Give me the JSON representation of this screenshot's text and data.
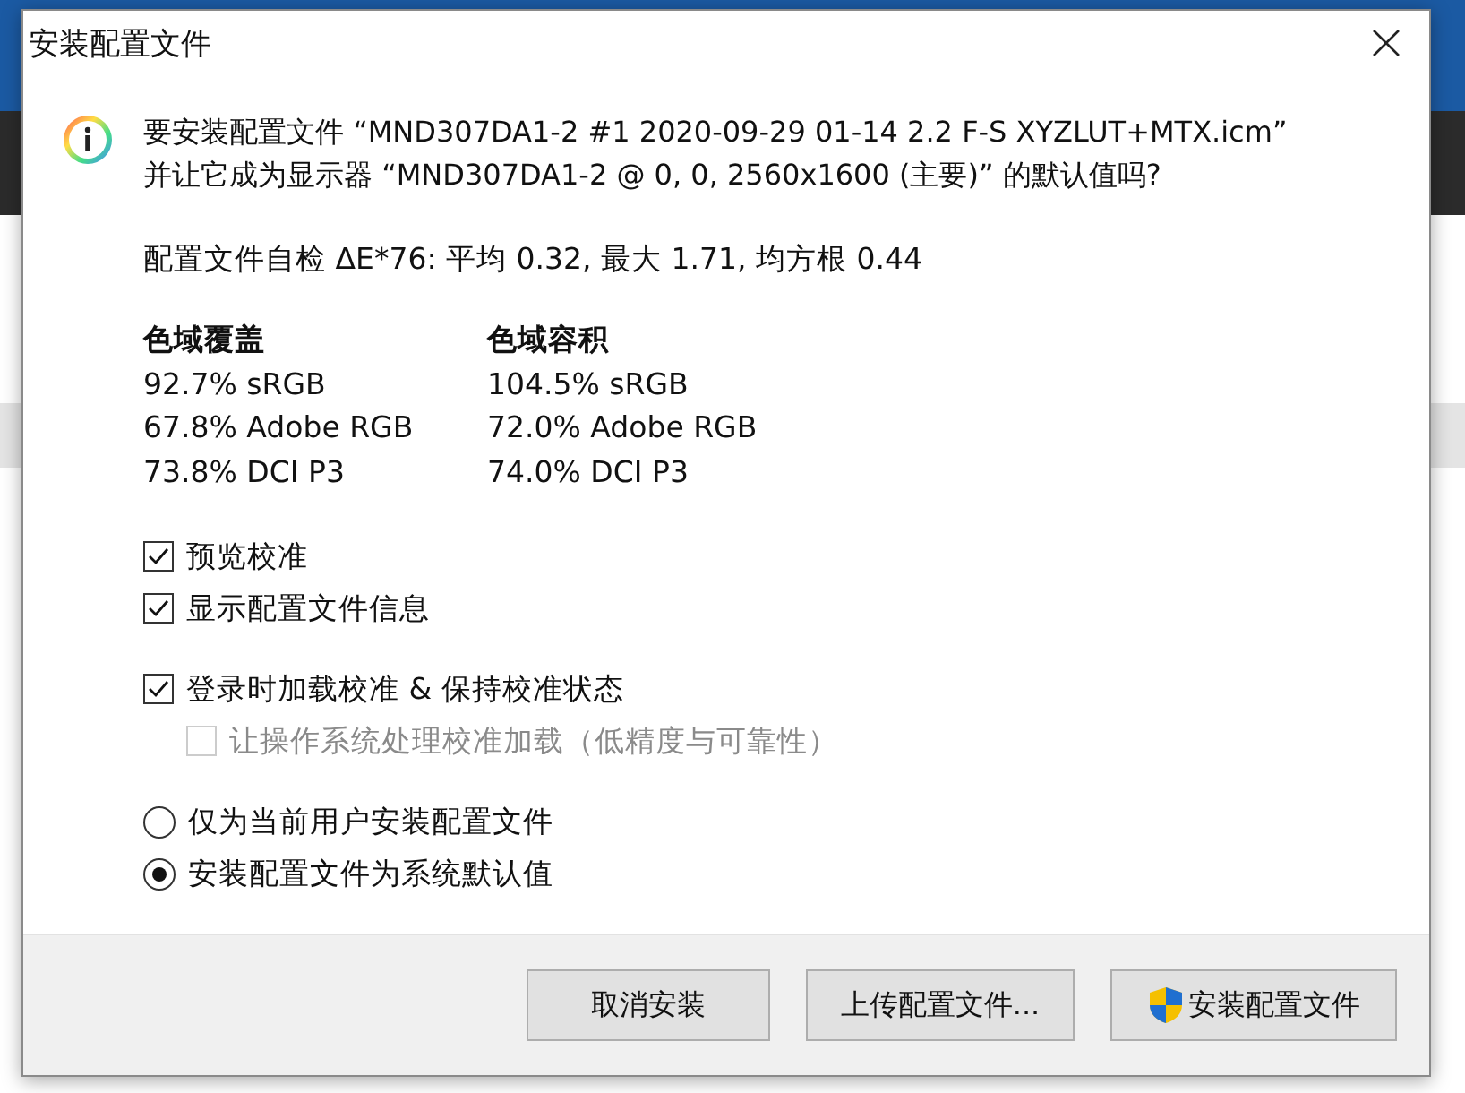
{
  "window": {
    "title": "安装配置文件"
  },
  "message": [
    "要安装配置文件 “MND307DA1-2 #1 2020-09-29 01-14 2.2 F-S XYZLUT+MTX.icm”",
    "并让它成为显示器 “MND307DA1-2 @ 0, 0, 2560x1600 (主要)” 的默认值吗?"
  ],
  "self_check": "配置文件自检 ΔE*76: 平均 0.32, 最大 1.71, 均方根 0.44",
  "gamut_columns": [
    {
      "heading": "色域覆盖",
      "values": [
        "92.7% sRGB",
        "67.8% Adobe RGB",
        "73.8% DCI P3"
      ]
    },
    {
      "heading": "色域容积",
      "values": [
        "104.5% sRGB",
        "72.0% Adobe RGB",
        "74.0% DCI P3"
      ]
    }
  ],
  "option_groups": [
    [
      {
        "kind": "checkbox",
        "label": "预览校准",
        "checked": true,
        "disabled": false
      },
      {
        "kind": "checkbox",
        "label": "显示配置文件信息",
        "checked": true,
        "disabled": false
      }
    ],
    [
      {
        "kind": "checkbox",
        "label": "登录时加载校准 & 保持校准状态",
        "checked": true,
        "disabled": false,
        "children": [
          {
            "kind": "checkbox",
            "label": "让操作系统处理校准加载（低精度与可靠性）",
            "checked": false,
            "disabled": true
          }
        ]
      }
    ],
    [
      {
        "kind": "radio",
        "label": "仅为当前用户安装配置文件",
        "selected": false
      },
      {
        "kind": "radio",
        "label": "安装配置文件为系统默认值",
        "selected": true
      }
    ]
  ],
  "buttons": [
    {
      "label": "取消安装",
      "shield": false
    },
    {
      "label": "上传配置文件...",
      "shield": false
    },
    {
      "label": "安装配置文件",
      "shield": true
    }
  ]
}
